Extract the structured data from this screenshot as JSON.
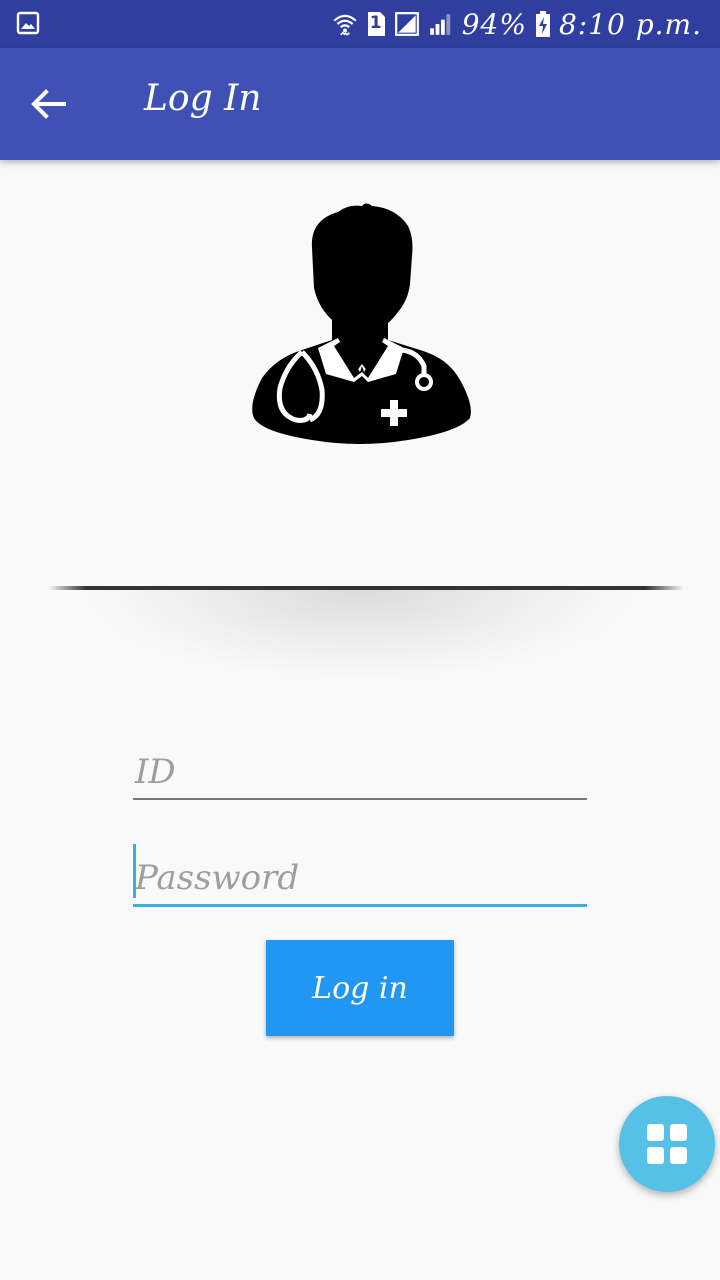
{
  "status_bar": {
    "sim_slot": "1",
    "battery": "94%",
    "time": "8:10 p.m.",
    "icons": [
      "gallery-icon",
      "wifi-icon",
      "sim-icon",
      "signal-icon",
      "signal-bars-icon",
      "battery-charging-icon"
    ]
  },
  "app_bar": {
    "title": "Log In",
    "back_icon": "arrow-back-icon",
    "color": "#3f51b5"
  },
  "logo": {
    "icon": "doctor-stethoscope-icon"
  },
  "form": {
    "id_field": {
      "value": "",
      "placeholder": "ID"
    },
    "password_field": {
      "value": "",
      "placeholder": "Password",
      "focused": true
    }
  },
  "login_button": {
    "label": "Log in",
    "color": "#2196f3"
  },
  "fab": {
    "icon": "grid-apps-icon",
    "color": "#56c1e6"
  }
}
